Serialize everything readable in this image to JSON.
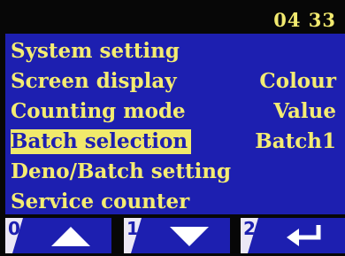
{
  "status": {
    "time": "04 33"
  },
  "menu": {
    "items": [
      {
        "label": "System setting",
        "value": "",
        "selected": false
      },
      {
        "label": "Screen display",
        "value": "Colour",
        "selected": false
      },
      {
        "label": "Counting mode",
        "value": "Value",
        "selected": false
      },
      {
        "label": "Batch selection",
        "value": "Batch1",
        "selected": true
      },
      {
        "label": "Deno/Batch setting",
        "value": "",
        "selected": false
      },
      {
        "label": "Service counter",
        "value": "",
        "selected": false
      }
    ]
  },
  "softkeys": [
    {
      "number": "0",
      "icon": "arrow-up-icon"
    },
    {
      "number": "1",
      "icon": "arrow-down-icon"
    },
    {
      "number": "2",
      "icon": "enter-icon"
    }
  ],
  "colors": {
    "background": "#070707",
    "menu_background": "#1d1fb0",
    "text": "#f4ec72",
    "selection_highlight": "#f0e96b"
  }
}
